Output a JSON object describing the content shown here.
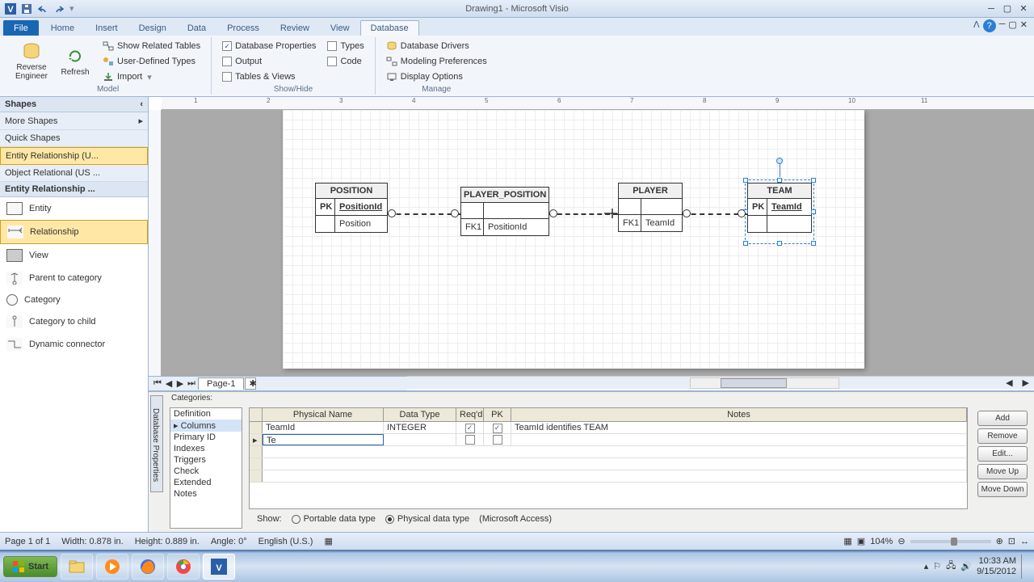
{
  "app": {
    "title": "Drawing1 - Microsoft Visio"
  },
  "qat": {
    "save": "Save",
    "undo": "Undo",
    "redo": "Redo"
  },
  "tabs": {
    "file": "File",
    "home": "Home",
    "insert": "Insert",
    "design": "Design",
    "data": "Data",
    "process": "Process",
    "review": "Review",
    "view": "View",
    "database": "Database"
  },
  "ribbon": {
    "model": {
      "label": "Model",
      "reverse": "Reverse\nEngineer",
      "refresh": "Refresh",
      "related": "Show Related Tables",
      "udt": "User-Defined Types",
      "import": "Import"
    },
    "showhide": {
      "label": "Show/Hide",
      "dbprops": "Database Properties",
      "output": "Output",
      "tables": "Tables & Views",
      "types": "Types",
      "code": "Code"
    },
    "manage": {
      "label": "Manage",
      "drivers": "Database Drivers",
      "prefs": "Modeling Preferences",
      "display": "Display Options"
    }
  },
  "shapes": {
    "title": "Shapes",
    "more": "More Shapes",
    "quick": "Quick Shapes",
    "er": "Entity Relationship (U...",
    "or": "Object Relational (US ...",
    "er_hdr": "Entity Relationship ...",
    "items": {
      "entity": "Entity",
      "relationship": "Relationship",
      "view": "View",
      "parent": "Parent to category",
      "category": "Category",
      "child": "Category to child",
      "dynamic": "Dynamic connector"
    }
  },
  "entities": {
    "position": {
      "name": "POSITION",
      "pk": "PK",
      "pkf": "PositionId",
      "f1": "Position"
    },
    "pp": {
      "name": "PLAYER_POSITION",
      "fk": "FK1",
      "fkf": "PositionId"
    },
    "player": {
      "name": "PLAYER",
      "fk": "FK1",
      "fkf": "TeamId"
    },
    "team": {
      "name": "TEAM",
      "pk": "PK",
      "pkf": "TeamId"
    }
  },
  "pagetab": {
    "page1": "Page-1"
  },
  "dbprops": {
    "title": "Database Properties",
    "categories": "Categories:",
    "cats": {
      "def": "Definition",
      "cols": "Columns",
      "pid": "Primary ID",
      "idx": "Indexes",
      "trig": "Triggers",
      "chk": "Check",
      "ext": "Extended",
      "notes": "Notes"
    },
    "grid": {
      "physname": "Physical Name",
      "datatype": "Data Type",
      "reqd": "Req'd",
      "pk": "PK",
      "notes": "Notes"
    },
    "rows": [
      {
        "name": "TeamId",
        "type": "INTEGER",
        "reqd": true,
        "pk": true,
        "notes": "TeamId identifies TEAM"
      },
      {
        "name": "Te",
        "type": "",
        "reqd": false,
        "pk": false,
        "notes": ""
      }
    ],
    "btns": {
      "add": "Add",
      "remove": "Remove",
      "edit": "Edit...",
      "up": "Move Up",
      "down": "Move Down"
    },
    "show": "Show:",
    "portable": "Portable data type",
    "physical": "Physical data type",
    "access": "(Microsoft Access)"
  },
  "status": {
    "page": "Page 1 of 1",
    "width": "Width: 0.878 in.",
    "height": "Height: 0.889 in.",
    "angle": "Angle: 0°",
    "lang": "English (U.S.)",
    "zoom": "104%"
  },
  "taskbar": {
    "start": "Start",
    "time": "10:33 AM",
    "date": "9/15/2012"
  }
}
